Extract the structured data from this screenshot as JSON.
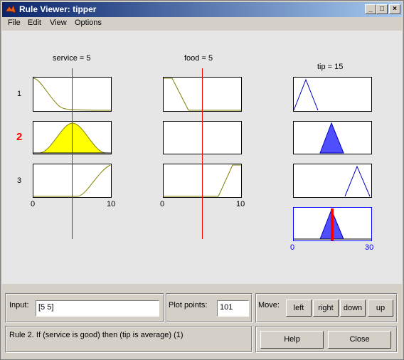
{
  "window": {
    "title": "Rule Viewer: tipper"
  },
  "menu": [
    "File",
    "Edit",
    "View",
    "Options"
  ],
  "inputs": [
    {
      "label": "service = 5",
      "range": [
        "0",
        "10"
      ],
      "value": 5
    },
    {
      "label": "food = 5",
      "range": [
        "0",
        "10"
      ],
      "value": 5
    }
  ],
  "output": {
    "label": "tip = 15",
    "range": [
      "0",
      "30"
    ],
    "value": 15
  },
  "rules": [
    "1",
    "2",
    "3"
  ],
  "active_rule": "2",
  "input_panel": {
    "label": "Input:",
    "value": "[5 5]"
  },
  "plot_points": {
    "label": "Plot points:",
    "value": "101"
  },
  "move": {
    "label": "Move:",
    "buttons": [
      "left",
      "right",
      "down",
      "up"
    ]
  },
  "status": "Rule 2. If (service is good) then (tip is average) (1)",
  "help_label": "Help",
  "close_label": "Close",
  "colors": {
    "highlight_fill": "#ffff00",
    "output_fill": "#4f4fff",
    "line": "#ff0000",
    "curve": "#808000",
    "output_line": "#0000c0"
  }
}
